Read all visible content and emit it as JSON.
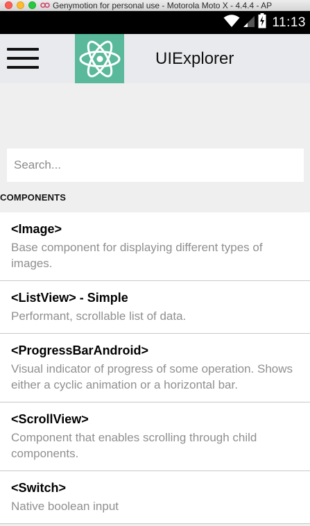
{
  "window": {
    "title": "Genymotion for personal use - Motorola Moto X - 4.4.4 - AP"
  },
  "status_bar": {
    "time": "11:13",
    "icons": [
      "wifi-icon",
      "signal-icon",
      "battery-charging-icon"
    ]
  },
  "toolbar": {
    "menu_icon": "hamburger-menu-icon",
    "logo_icon": "react-atom-icon",
    "logo_bg_color": "#59b99a",
    "title": "UIExplorer"
  },
  "search": {
    "placeholder": "Search...",
    "value": ""
  },
  "section": {
    "header": "COMPONENTS"
  },
  "items": [
    {
      "title": "<Image>",
      "description": "Base component for displaying different types of images."
    },
    {
      "title": "<ListView> - Simple",
      "description": "Performant, scrollable list of data."
    },
    {
      "title": "<ProgressBarAndroid>",
      "description": "Visual indicator of progress of some operation. Shows either a cyclic animation or a horizontal bar."
    },
    {
      "title": "<ScrollView>",
      "description": "Component that enables scrolling through child components."
    },
    {
      "title": "<Switch>",
      "description": "Native boolean input"
    }
  ]
}
